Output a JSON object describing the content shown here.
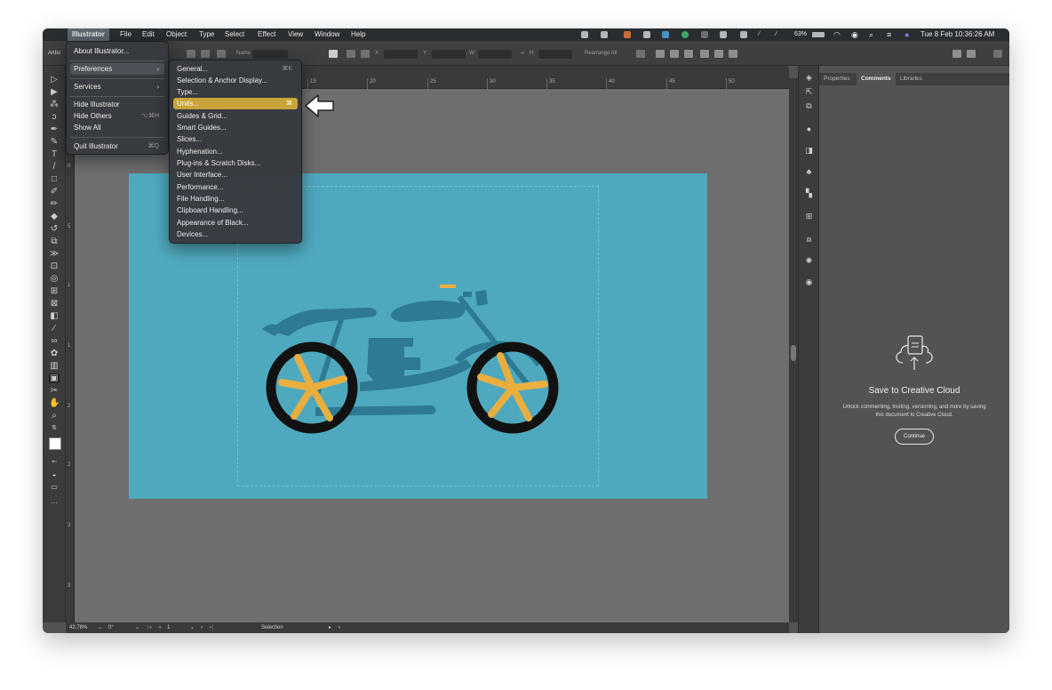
{
  "menubar": {
    "app": "Illustrator",
    "items": [
      "File",
      "Edit",
      "Object",
      "Type",
      "Select",
      "Effect",
      "View",
      "Window",
      "Help"
    ],
    "battery": "63%",
    "clock": "Tue 8 Feb  10:36:26 AM"
  },
  "controlbar": {
    "artboard_label": "Artbo",
    "name_label": "Name",
    "x_label": "X:",
    "y_label": "Y:",
    "w_label": "W:",
    "h_label": "H:",
    "rearrange": "Rearrange All"
  },
  "ruler": {
    "marks": [
      "15",
      "20",
      "25",
      "30",
      "35",
      "40",
      "45",
      "50"
    ]
  },
  "left_ruler": {
    "marks": [
      "0",
      "5",
      "1",
      "1",
      "2",
      "2",
      "3",
      "3",
      "4"
    ]
  },
  "app_menu": {
    "items": [
      {
        "label": "About Illustrator...",
        "shortcut": ""
      },
      {
        "label": "Preferences",
        "shortcut": "",
        "submenu": true
      },
      {
        "label": "Services",
        "shortcut": "",
        "submenu": true
      },
      {
        "label": "Hide Illustrator",
        "shortcut": ""
      },
      {
        "label": "Hide Others",
        "shortcut": "⌥⌘H"
      },
      {
        "label": "Show All",
        "shortcut": ""
      },
      {
        "label": "Quit Illustrator",
        "shortcut": "⌘Q"
      }
    ]
  },
  "prefs_menu": {
    "items": [
      {
        "label": "General...",
        "shortcut": "⌘K"
      },
      {
        "label": "Selection & Anchor Display...",
        "shortcut": ""
      },
      {
        "label": "Type...",
        "shortcut": ""
      },
      {
        "label": "Units...",
        "shortcut": "⌘",
        "highlighted": true
      },
      {
        "label": "Guides & Grid...",
        "shortcut": ""
      },
      {
        "label": "Smart Guides...",
        "shortcut": ""
      },
      {
        "label": "Slices...",
        "shortcut": ""
      },
      {
        "label": "Hyphenation...",
        "shortcut": ""
      },
      {
        "label": "Plug-ins & Scratch Disks...",
        "shortcut": ""
      },
      {
        "label": "User Interface...",
        "shortcut": ""
      },
      {
        "label": "Performance...",
        "shortcut": ""
      },
      {
        "label": "File Handling...",
        "shortcut": ""
      },
      {
        "label": "Clipboard Handling...",
        "shortcut": ""
      },
      {
        "label": "Appearance of Black...",
        "shortcut": ""
      },
      {
        "label": "Devices...",
        "shortcut": ""
      }
    ]
  },
  "panel": {
    "tabs": [
      "Properties",
      "Comments",
      "Libraries"
    ],
    "active_tab": "Comments",
    "cc_title": "Save to Creative Cloud",
    "cc_desc": "Unlock commenting, inviting, versioning, and more by saving this document to Creative Cloud.",
    "continue": "Continue"
  },
  "statusbar": {
    "zoom": "42.78%",
    "rotation": "0°",
    "artboard": "1",
    "tool": "Selection"
  },
  "colors": {
    "artboard": "#4fa9be",
    "bike_body": "#2e7a92",
    "wheel": "#111111",
    "spokes": "#eaae3f",
    "highlight": "#c9a43b"
  }
}
